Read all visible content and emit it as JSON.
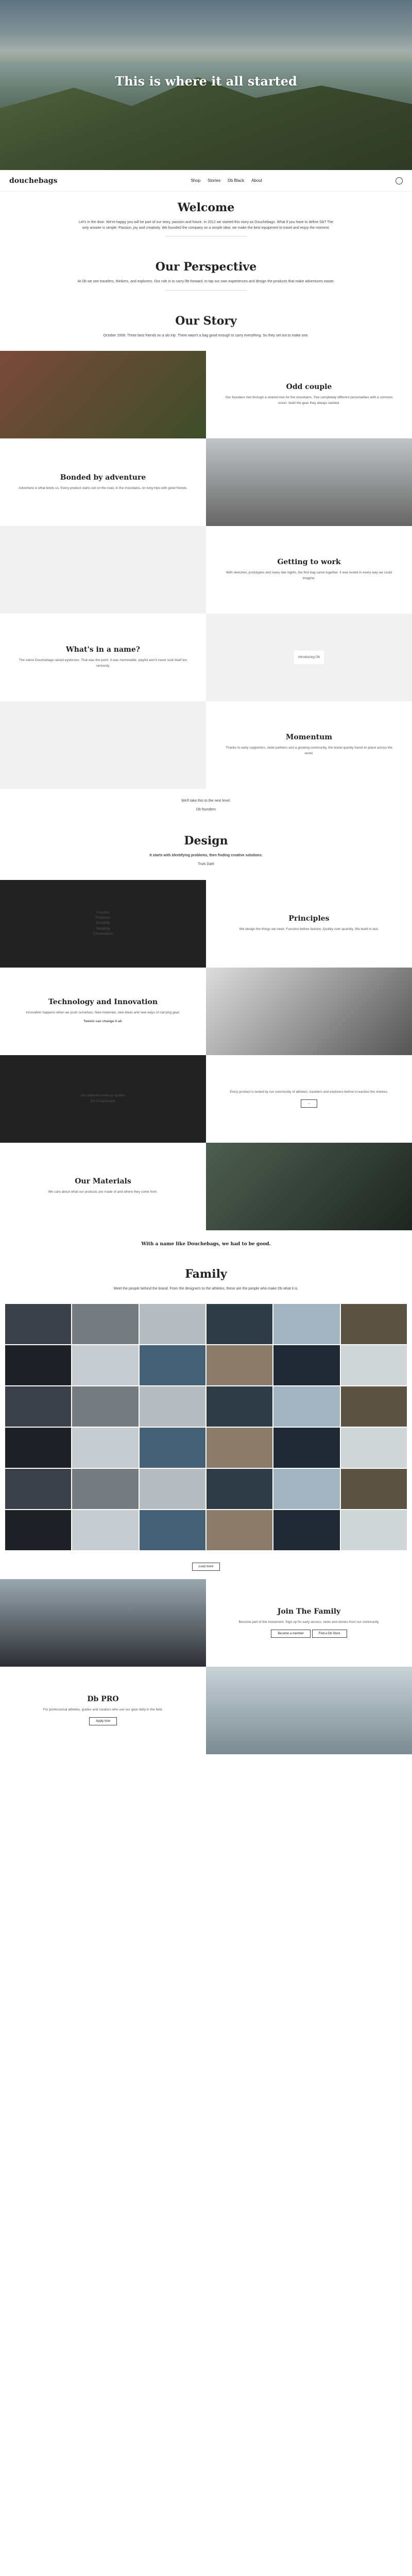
{
  "hero": {
    "title": "This is where it all started"
  },
  "nav": {
    "logo": "douchebags",
    "items": [
      "Shop",
      "Stories",
      "Db Black",
      "About"
    ]
  },
  "welcome": {
    "title": "Welcome",
    "text": "Let's in the door. We're happy you will be part of our story, passion and future. In 2012 we started this story as Douchebags. What if you have to define Db? The only answer is simple: Passion, joy and creativity. We founded the company on a simple idea: we make the best equipment to travel and enjoy the moment."
  },
  "perspective": {
    "title": "Our Perspective",
    "text": "At Db we see travelers, thinkers, and explorers. Our role is to carry life forward, to tap our own experiences and design the products that make adventures easier."
  },
  "story": {
    "title": "Our Story",
    "text": "October 2008. Three best friends on a ski trip. There wasn't a bag good enough to carry everything. So they set out to make one."
  },
  "oddcouple": {
    "title": "Odd couple",
    "text": "Our founders met through a shared love for the mountains. Two completely different personalities with a common vision: build the gear they always wanted."
  },
  "bonded": {
    "title": "Bonded by adventure",
    "text": "Adventure is what binds us. Every product starts out on the road, in the mountains, on long trips with good friends."
  },
  "work": {
    "title": "Getting to work",
    "text": "With sketches, prototypes and many late nights, the first bag came together. It was tested in every way we could imagine."
  },
  "name": {
    "title": "What's in a name?",
    "text": "The name Douchebags raised eyebrows. That was the point. It was memorable, playful and it never took itself too seriously.",
    "card": "Introducing Db"
  },
  "momentum": {
    "title": "Momentum",
    "text": "Thanks to early supporters, retail partners and a growing community, the brand quickly found its place across the world."
  },
  "momentum_quote": {
    "text": "We'll take this to the next level.",
    "author": "Db founders"
  },
  "design": {
    "title": "Design",
    "quote": "It starts with identifying problems, then finding creative solutions.",
    "author": "Truls Dahl"
  },
  "principles": {
    "title": "Principles",
    "text": "We design the things we need. Function before fashion. Quality over quantity. We build to last.",
    "list": [
      "Function",
      "Protection",
      "Durability",
      "Simplicity",
      "Conservation"
    ]
  },
  "tech": {
    "title": "Technology and Innovation",
    "text": "Innovation happens when we push ourselves. New materials, new ideas and new ways of carrying gear.",
    "quote": "Tweets can change it all."
  },
  "testing": {
    "text": "Every product is tested by our community of athletes, travelers and explorers before it reaches the shelves.",
    "label": "Our patented hook-up system",
    "label2": "Db Compression"
  },
  "materials": {
    "title": "Our Materials",
    "text": "We care about what our products are made of and where they come from."
  },
  "name_quote": "With a name like Douchebags, we had to be good.",
  "family": {
    "title": "Family",
    "text": "Meet the people behind the brand. From the designers to the athletes, these are the people who make Db what it is.",
    "button": "Load more"
  },
  "join": {
    "title": "Join The Family",
    "text": "Become part of the movement. Sign up for early access, news and stories from our community.",
    "btn1": "Become a member",
    "btn2": "Find a Db Store"
  },
  "pro": {
    "title": "Db PRO",
    "text": "For professional athletes, guides and creators who use our gear daily in the field.",
    "button": "Apply now"
  }
}
